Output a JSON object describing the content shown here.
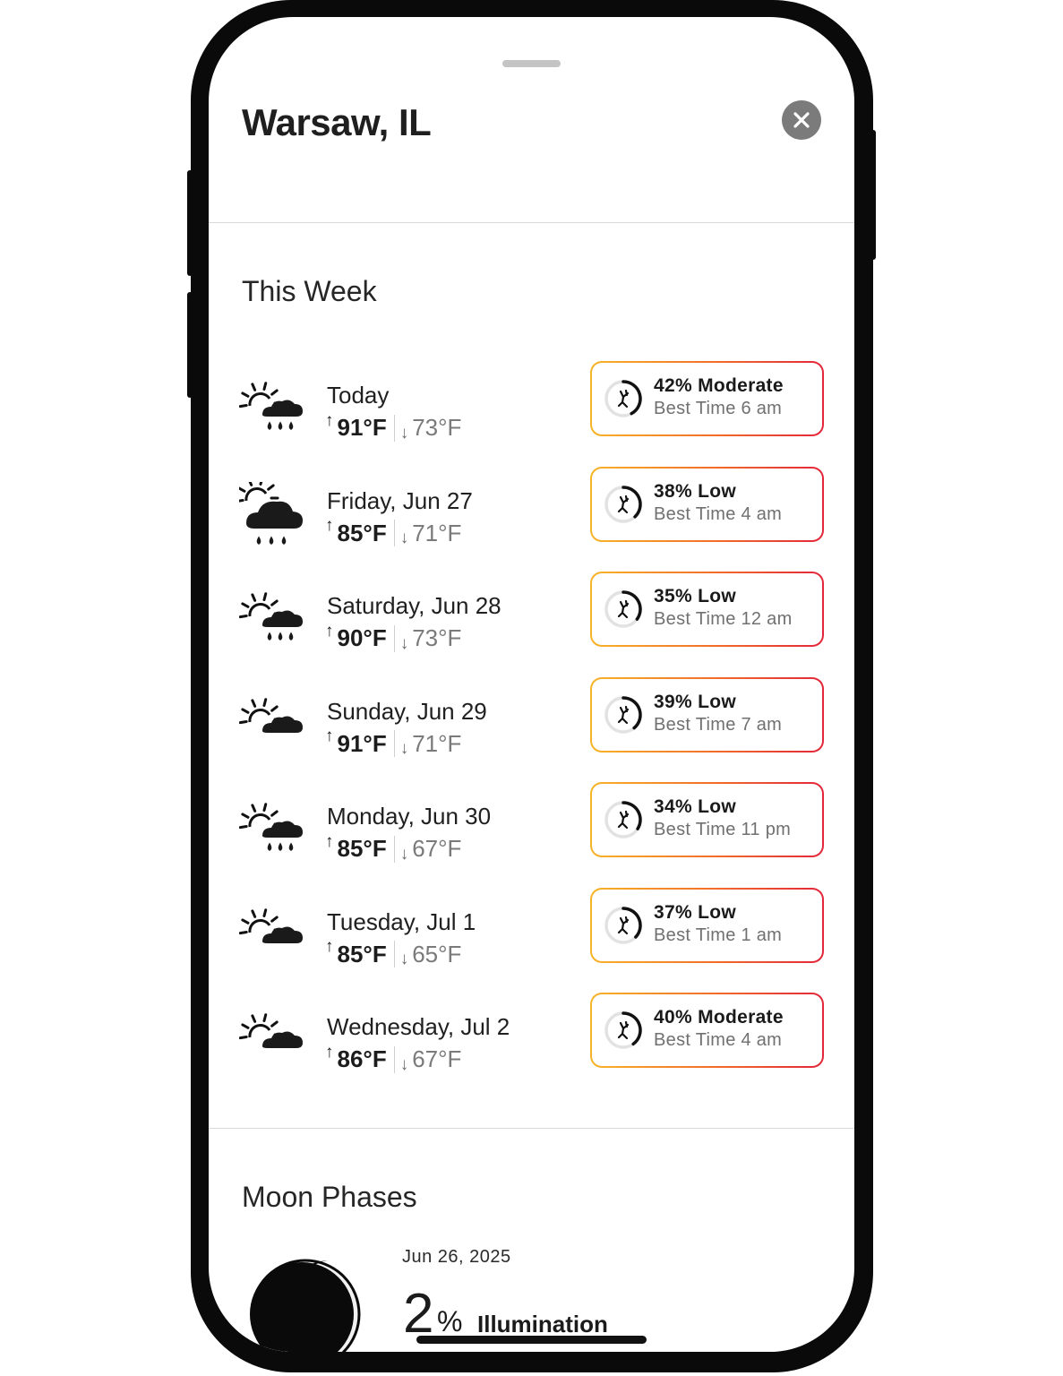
{
  "sheet": {
    "location_title": "Warsaw, IL",
    "close_icon": "close-icon"
  },
  "this_week": {
    "heading": "This Week",
    "days": [
      {
        "name": "Today",
        "icon": "partly-cloudy-rain-icon",
        "high": "91°F",
        "low": "73°F",
        "activity_pct": "42% Moderate",
        "best_time": "Best Time 6 am",
        "gauge_fraction": 0.42
      },
      {
        "name": "Friday, Jun 27",
        "icon": "cloud-rain-icon",
        "high": "85°F",
        "low": "71°F",
        "activity_pct": "38% Low",
        "best_time": "Best Time 4 am",
        "gauge_fraction": 0.38
      },
      {
        "name": "Saturday, Jun 28",
        "icon": "partly-cloudy-rain-icon",
        "high": "90°F",
        "low": "73°F",
        "activity_pct": "35% Low",
        "best_time": "Best Time 12 am",
        "gauge_fraction": 0.35
      },
      {
        "name": "Sunday, Jun 29",
        "icon": "partly-cloudy-icon",
        "high": "91°F",
        "low": "71°F",
        "activity_pct": "39% Low",
        "best_time": "Best Time 7 am",
        "gauge_fraction": 0.39
      },
      {
        "name": "Monday, Jun 30",
        "icon": "partly-cloudy-rain-icon",
        "high": "85°F",
        "low": "67°F",
        "activity_pct": "34% Low",
        "best_time": "Best Time 11 pm",
        "gauge_fraction": 0.34
      },
      {
        "name": "Tuesday, Jul 1",
        "icon": "partly-cloudy-icon",
        "high": "85°F",
        "low": "65°F",
        "activity_pct": "37% Low",
        "best_time": "Best Time 1 am",
        "gauge_fraction": 0.37
      },
      {
        "name": "Wednesday, Jul 2",
        "icon": "partly-cloudy-icon",
        "high": "86°F",
        "low": "67°F",
        "activity_pct": "40% Moderate",
        "best_time": "Best Time 4 am",
        "gauge_fraction": 0.4
      }
    ]
  },
  "moon": {
    "heading": "Moon Phases",
    "date": "Jun 26, 2025",
    "illumination_value": "2",
    "illumination_unit": "%",
    "illumination_label": "Illumination"
  },
  "colors": {
    "badge_gradient_start": "#f7b428",
    "badge_gradient_mid": "#f26a2a",
    "badge_gradient_end": "#e2263a",
    "close_button": "#7b7b7b"
  }
}
